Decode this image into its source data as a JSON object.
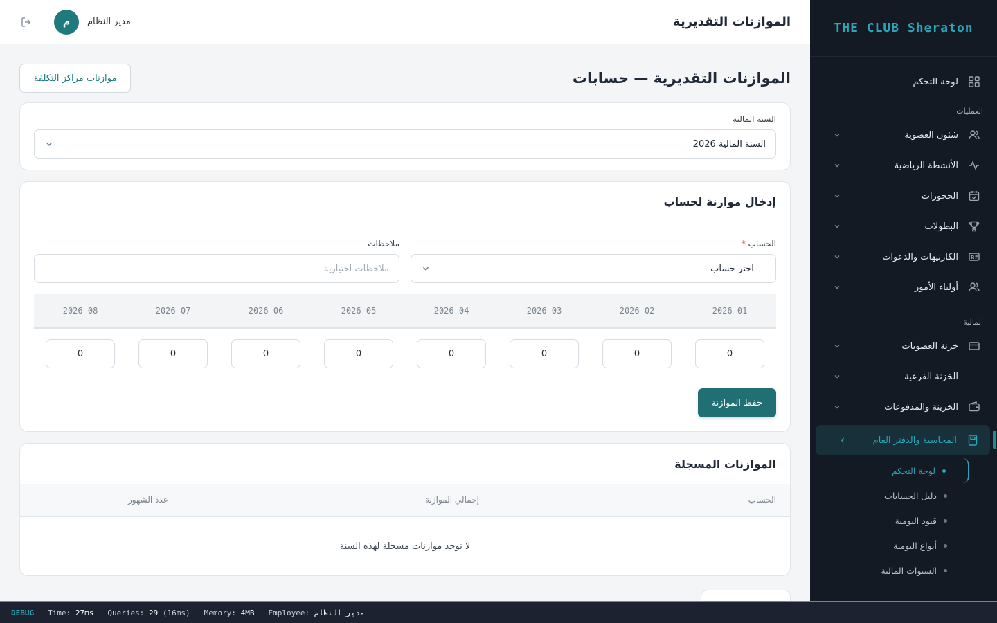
{
  "sidebar": {
    "brand": "THE CLUB Sheraton",
    "dashboard": "لوحة التحكم",
    "section_operations": "العمليات",
    "operations": [
      {
        "label": "شئون العضوية",
        "icon": "users-icon"
      },
      {
        "label": "الأنشطة الرياضية",
        "icon": "activity-icon"
      },
      {
        "label": "الحجوزات",
        "icon": "calendar-check-icon"
      },
      {
        "label": "البطولات",
        "icon": "trophy-icon"
      },
      {
        "label": "الكارنيهات والدعوات",
        "icon": "id-card-icon"
      },
      {
        "label": "أولياء الأمور",
        "icon": "users-icon"
      }
    ],
    "section_finance": "المالية",
    "finance": [
      {
        "label": "خزنة العضويات",
        "icon": "card-icon"
      },
      {
        "label": "الخزنة الفرعية",
        "icon": ""
      },
      {
        "label": "الخزينة والمدفوعات",
        "icon": "wallet-icon"
      }
    ],
    "accounting": "المحاسبة والدفتر العام",
    "sub": [
      "لوحة التحكم",
      "دليل الحسابات",
      "قيود اليومية",
      "أنواع اليومية",
      "السنوات المالية"
    ]
  },
  "topbar": {
    "title": "الموازنات التقديرية",
    "user_name": "مدير النظام",
    "avatar_letter": "م"
  },
  "page": {
    "heading": "الموازنات التقديرية — حسابات",
    "cost_center_button": "موازنات مراكز التكلفة"
  },
  "fiscal": {
    "label": "السنة المالية",
    "value": "السنة المالية 2026"
  },
  "entry": {
    "title": "إدخال موازنة لحساب",
    "account_label": "الحساب",
    "required_mark": "*",
    "account_value": "— اختر حساب —",
    "notes_label": "ملاحظات",
    "notes_placeholder": "ملاحظات اختيارية",
    "months": [
      "2026-01",
      "2026-02",
      "2026-03",
      "2026-04",
      "2026-05",
      "2026-06",
      "2026-07",
      "2026-08"
    ],
    "values": [
      "0",
      "0",
      "0",
      "0",
      "0",
      "0",
      "0",
      "0"
    ],
    "save_label": "حفظ الموازنة"
  },
  "registered": {
    "title": "الموازنات المسجلة",
    "col_account": "الحساب",
    "col_total": "إجمالي الموازنة",
    "col_months": "عدد الشهور",
    "empty": "لا توجد موازنات مسجلة لهذه السنة"
  },
  "debug": {
    "tag": "DEBUG",
    "time_label": "Time:",
    "time": "27ms",
    "queries_label": "Queries:",
    "queries": "29",
    "queries_time": "(16ms)",
    "memory_label": "Memory:",
    "memory": "4MB",
    "employee_label": "Employee:",
    "employee": "مدير النظام"
  },
  "colors": {
    "sidebar_bg": "#131a24",
    "accent": "#2aa6b8",
    "primary": "#1f6f73"
  }
}
